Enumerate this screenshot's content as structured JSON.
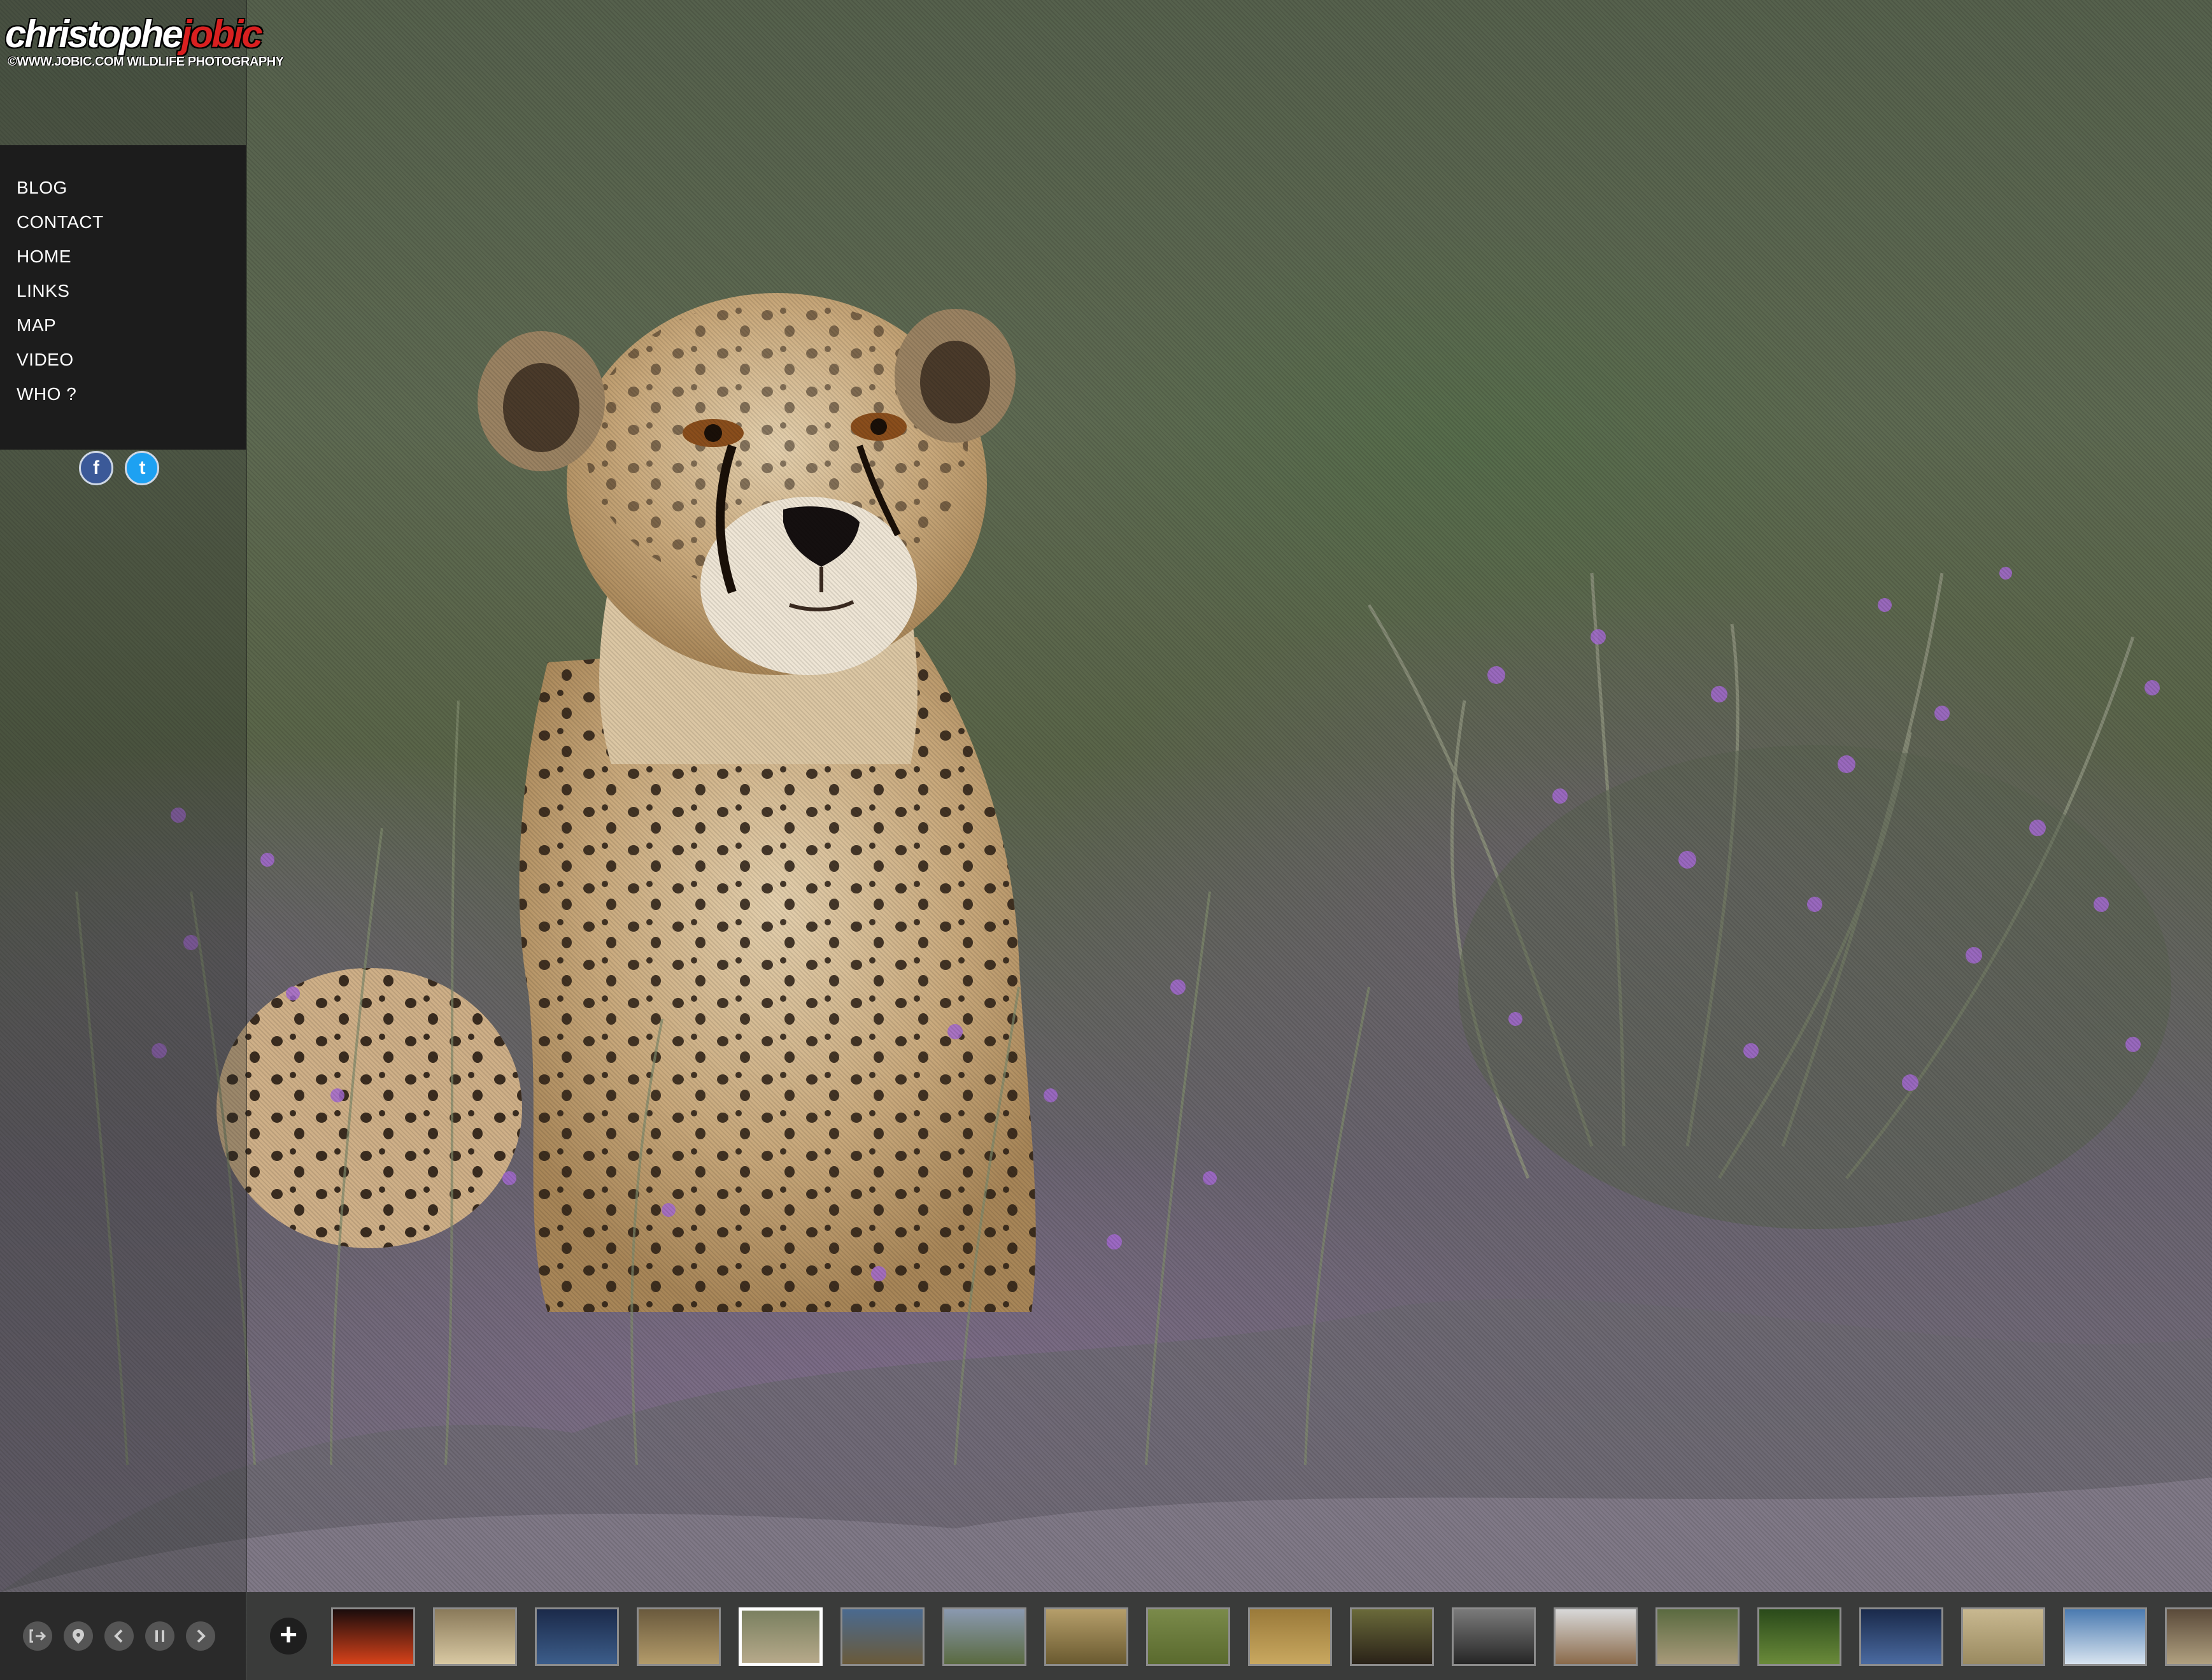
{
  "brand": {
    "name_first": "christophe",
    "name_last": "jobic",
    "tagline": "©WWW.JOBIC.COM  WILDLIFE PHOTOGRAPHY"
  },
  "menu": {
    "items": [
      "BLOG",
      "CONTACT",
      "HOME",
      "LINKS",
      "MAP",
      "VIDEO",
      "WHO ?"
    ]
  },
  "social": {
    "facebook_glyph": "f",
    "twitter_glyph": "t"
  },
  "controls": {
    "exit_icon": "exit-icon",
    "map_pin_icon": "map-pin-icon",
    "prev_icon": "chevron-left-icon",
    "pause_icon": "pause-icon",
    "next_icon": "chevron-right-icon",
    "add_glyph": "+"
  },
  "thumbnails": [
    {
      "subject": "sunset",
      "colors": [
        "#1a0c0c",
        "#d8421a"
      ]
    },
    {
      "subject": "birds",
      "colors": [
        "#8a7a5a",
        "#d9c9a3"
      ]
    },
    {
      "subject": "zebra-night",
      "colors": [
        "#1b2a4a",
        "#3c5d8a"
      ]
    },
    {
      "subject": "eagle",
      "colors": [
        "#6a5a3d",
        "#b39b6a"
      ]
    },
    {
      "subject": "cheetah",
      "colors": [
        "#7a8060",
        "#b6a98a"
      ],
      "active": true
    },
    {
      "subject": "wildebeest",
      "colors": [
        "#4a6a90",
        "#6a5a3a"
      ]
    },
    {
      "subject": "plain",
      "colors": [
        "#8a99b0",
        "#5a6a40"
      ]
    },
    {
      "subject": "lion",
      "colors": [
        "#b59e6a",
        "#6a5a30"
      ]
    },
    {
      "subject": "grass",
      "colors": [
        "#7a8a4a",
        "#5a6a2e"
      ]
    },
    {
      "subject": "meerkats",
      "colors": [
        "#9a7a3a",
        "#c9a860"
      ]
    },
    {
      "subject": "buffalo",
      "colors": [
        "#6a6a3a",
        "#2a2218"
      ]
    },
    {
      "subject": "panther",
      "colors": [
        "#7a7a7a",
        "#262626"
      ]
    },
    {
      "subject": "puma-snow",
      "colors": [
        "#d8d8d8",
        "#8a6a4a"
      ]
    },
    {
      "subject": "river",
      "colors": [
        "#5a6a40",
        "#a89a7a"
      ]
    },
    {
      "subject": "leopard-tree",
      "colors": [
        "#2a4a1a",
        "#6a8a3a"
      ]
    },
    {
      "subject": "giraffe-night",
      "colors": [
        "#1a2a4a",
        "#4a6aa0"
      ]
    },
    {
      "subject": "savanna",
      "colors": [
        "#c8b890",
        "#9a8a60"
      ]
    },
    {
      "subject": "flamingo",
      "colors": [
        "#4a7ab0",
        "#d8e4f0"
      ]
    },
    {
      "subject": "cat",
      "colors": [
        "#5a4a3a",
        "#b0a080"
      ]
    }
  ]
}
